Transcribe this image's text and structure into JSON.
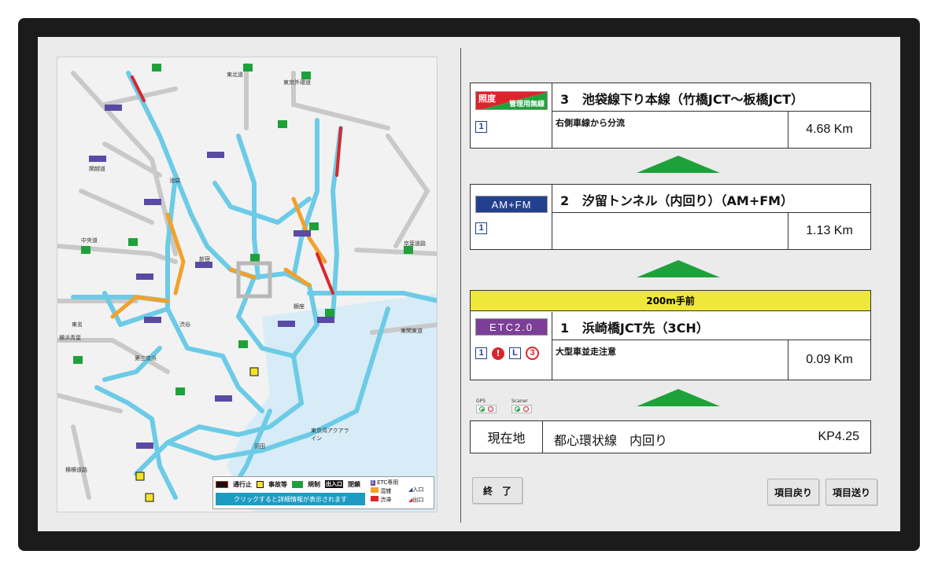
{
  "colors": {
    "accent_green": "#1fa13a",
    "banner_yellow": "#efe83a",
    "etc_purple": "#7b3f98",
    "amfm_blue": "#233f8f",
    "road_blue": "#6ccbe6",
    "congestion_orange": "#f2a12a",
    "jam_red": "#d9262c"
  },
  "cards": [
    {
      "number": "3",
      "title": "池袋線下り本線（竹橋JCT～板橋JCT）",
      "subtitle": "右側車線から分流",
      "distance": "4.68 Km",
      "icon_label_top": "照度",
      "icon_label_bottom": "管理用無線",
      "lane_icons": [
        "1"
      ]
    },
    {
      "number": "2",
      "title": "汐留トンネル（内回り）（AM+FM）",
      "subtitle": "",
      "distance": "1.13 Km",
      "icon_label": "AM+FM",
      "lane_icons": [
        "1"
      ]
    },
    {
      "banner": "200m手前",
      "number": "1",
      "title": "浜崎橋JCT先（3CH）",
      "subtitle": "大型車並走注意",
      "distance": "0.09 Km",
      "icon_label": "ETC2.0",
      "lane_icons": [
        "1",
        "!",
        "L",
        "3"
      ]
    }
  ],
  "indicators": {
    "gps_label": "GPS",
    "scanner_label": "Scaner"
  },
  "current": {
    "label": "現在地",
    "route": "都心環状線　内回り",
    "kp": "KP4.25"
  },
  "buttons": {
    "exit": "終　了",
    "prev": "項目戻り",
    "next": "項目送り"
  },
  "map": {
    "legend_closure": "通行止",
    "legend_accident": "事故等",
    "legend_restriction": "規制",
    "legend_ramp_closed": "閉鎖",
    "legend_ramp_closed_box": "出入口",
    "legend_etc": "ETC専用",
    "legend_congestion": "混雑",
    "legend_jam": "渋滞",
    "legend_in": "入口",
    "legend_out": "出口",
    "legend_hint": "クリックすると詳細情報が表示されます",
    "labels": {
      "tohoku": "東北道",
      "gaikan": "東京外環道",
      "kanetsu": "関越道",
      "chuo": "中央道",
      "keiyo": "京葉道路",
      "tomei": "東名",
      "yokohama_aoba": "横浜青葉",
      "higashi_kanto": "東関東道",
      "daisan_keihin": "第三京浜",
      "aqualine": "東京湾アクアライン",
      "yokoyoko": "横横道路",
      "shinjuku": "新宿",
      "ikebukuro": "池袋",
      "ginza": "銀座",
      "shibuya": "渋谷",
      "haneda": "羽田"
    }
  }
}
